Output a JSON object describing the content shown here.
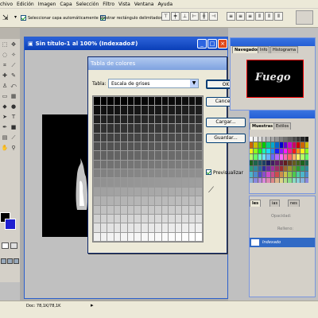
{
  "menu": [
    "chivo",
    "Edición",
    "Imagen",
    "Capa",
    "Selección",
    "Filtro",
    "Vista",
    "Ventana",
    "Ayuda"
  ],
  "options": {
    "autoselect_label": "Seleccionar capa automáticamente",
    "bounding_label": "Mostrar rectángulo delimitador"
  },
  "document": {
    "title": "Sin título-1 al 100% (Indexado#)"
  },
  "dialog": {
    "title": "Tabla de colores",
    "table_label": "Tabla:",
    "table_value": "Escala de grises",
    "ok": "OK",
    "cancel": "Cancelar",
    "load": "Cargar...",
    "save": "Guardar...",
    "preview_label": "Previsualizar",
    "preview_checked": true
  },
  "navigator": {
    "tabs": [
      "Navegador",
      "Info",
      "Histograma"
    ],
    "thumb_text": "Fuego"
  },
  "swatches_panel": {
    "tabs": [
      "Muestras",
      "Estilos"
    ]
  },
  "layers_panel": {
    "tabs": [
      "les",
      "ias",
      "nes"
    ],
    "opacity_label": "Opacidad:",
    "fill_label": "Relleno:",
    "layer_name": "Indexado"
  },
  "status": {
    "doc": "Doc: 78,1K/78,1K"
  },
  "colors": {
    "accent": "#245ed6",
    "close": "#e24a1b",
    "selected_row": "#316ac5"
  }
}
